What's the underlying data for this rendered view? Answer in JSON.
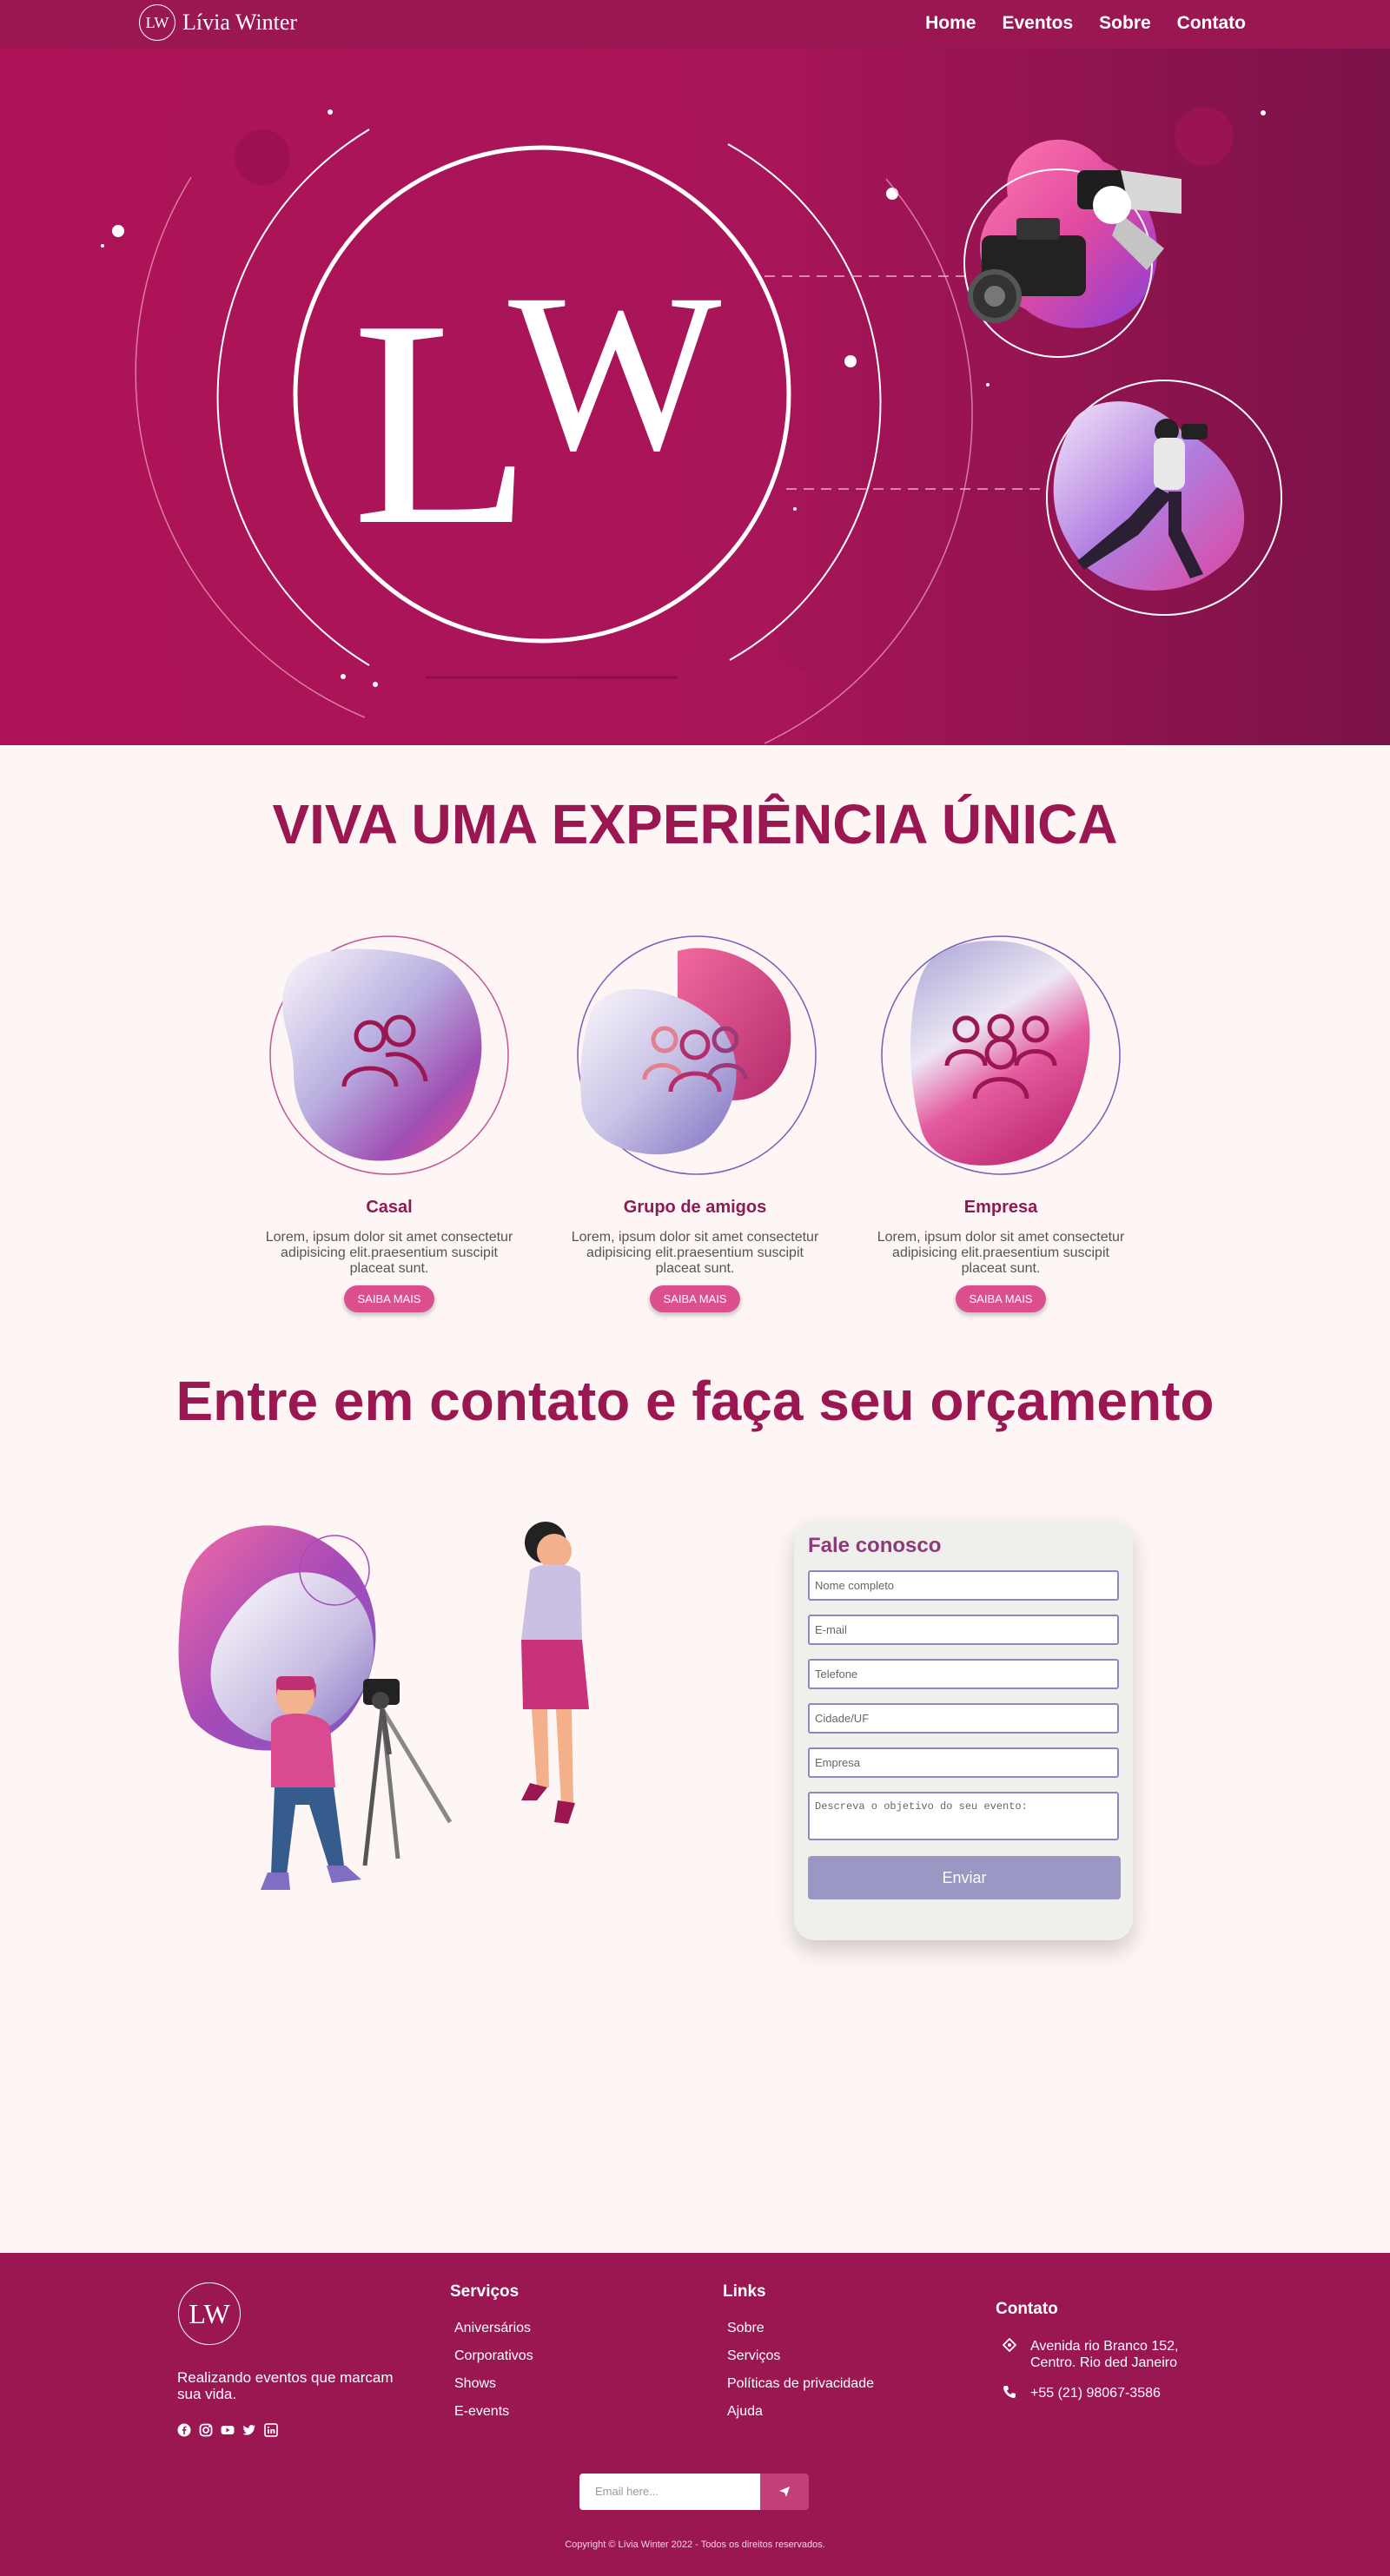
{
  "nav": {
    "logo_mono": "LW",
    "brand": "Lívia Winter",
    "links": [
      "Home",
      "Eventos",
      "Sobre",
      "Contato"
    ]
  },
  "hero": {
    "logo_letters": "LW"
  },
  "services": {
    "headline": "VIVA UMA EXPERIÊNCIA ÚNICA",
    "cards": [
      {
        "title": "Casal",
        "desc": "Lorem, ipsum dolor sit amet consectetur adipisicing elit.praesentium suscipit placeat sunt.",
        "button": "SAIBA MAIS",
        "icon": "couple-icon"
      },
      {
        "title": "Grupo de amigos",
        "desc": "Lorem, ipsum dolor sit amet consectetur adipisicing elit.praesentium suscipit placeat sunt.",
        "button": "SAIBA MAIS",
        "icon": "friends-icon"
      },
      {
        "title": "Empresa",
        "desc": "Lorem, ipsum dolor sit amet consectetur adipisicing elit.praesentium suscipit placeat sunt.",
        "button": "SAIBA MAIS",
        "icon": "company-icon"
      }
    ]
  },
  "contact": {
    "title": "Entre em contato e faça seu orçamento",
    "form": {
      "title": "Fale conosco",
      "placeholders": [
        "Nome completo",
        "E-mail",
        "Telefone",
        "Cidade/UF",
        "Empresa"
      ],
      "textarea_placeholder": "Descreva o objetivo do seu evento:",
      "submit": "Enviar"
    }
  },
  "footer": {
    "logo_mono": "LW",
    "tagline": "Realizando eventos que marcam sua vida.",
    "social_icons": [
      "facebook-icon",
      "instagram-icon",
      "youtube-icon",
      "twitter-icon",
      "linkedin-icon"
    ],
    "services": {
      "title": "Serviços",
      "items": [
        "Aniversários",
        "Corporativos",
        "Shows",
        "E-events"
      ]
    },
    "links": {
      "title": "Links",
      "items": [
        "Sobre",
        "Serviços",
        "Políticas de privacidade",
        "Ajuda"
      ]
    },
    "contact": {
      "title": "Contato",
      "address": "Avenida rio Branco 152, Centro. Rio ded Janeiro",
      "phone": "+55 (21) 98067-3586"
    },
    "newsletter_placeholder": "Email here...",
    "copyright": "Copyright © Lívia Winter 2022 - Todos os direitos reservados."
  },
  "colors": {
    "brand": "#9b1752",
    "accent": "#db4f8c",
    "form_button": "#9a97c4"
  }
}
